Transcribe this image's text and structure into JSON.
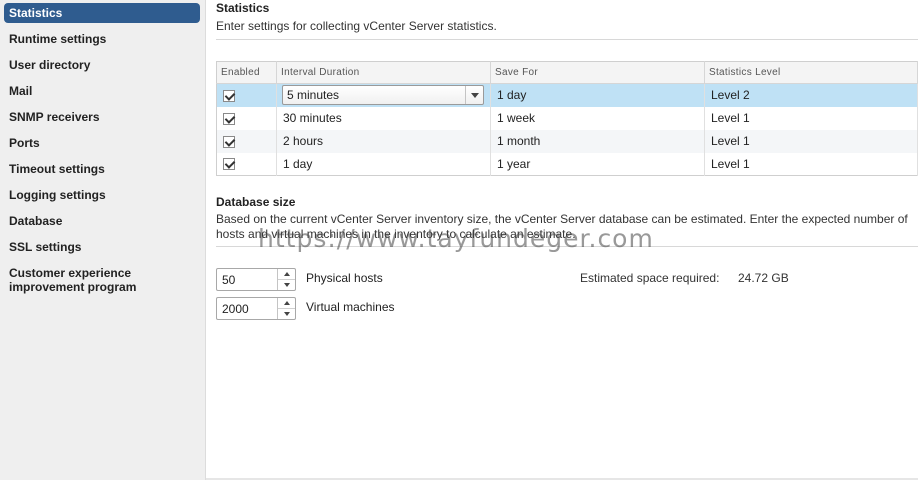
{
  "sidebar": {
    "items": [
      {
        "label": "Statistics",
        "active": true
      },
      {
        "label": "Runtime settings"
      },
      {
        "label": "User directory"
      },
      {
        "label": "Mail"
      },
      {
        "label": "SNMP receivers"
      },
      {
        "label": "Ports"
      },
      {
        "label": "Timeout settings"
      },
      {
        "label": "Logging settings"
      },
      {
        "label": "Database"
      },
      {
        "label": "SSL settings"
      },
      {
        "label": "Customer experience improvement program"
      }
    ]
  },
  "statistics": {
    "title": "Statistics",
    "description": "Enter settings for collecting vCenter Server statistics.",
    "table": {
      "headers": [
        "Enabled",
        "Interval Duration",
        "Save For",
        "Statistics Level"
      ],
      "rows": [
        {
          "enabled": true,
          "interval": "5 minutes",
          "save_for": "1 day",
          "level": "Level 2",
          "selected": true
        },
        {
          "enabled": true,
          "interval": "30 minutes",
          "save_for": "1 week",
          "level": "Level 1"
        },
        {
          "enabled": true,
          "interval": "2 hours",
          "save_for": "1 month",
          "level": "Level 1"
        },
        {
          "enabled": true,
          "interval": "1 day",
          "save_for": "1 year",
          "level": "Level 1"
        }
      ]
    }
  },
  "database": {
    "title": "Database size",
    "description": "Based on the current vCenter Server inventory size, the vCenter Server database can be estimated. Enter the expected number of hosts and virtual machines in the inventory to calculate an estimate.",
    "physical_hosts": {
      "value": "50",
      "label": "Physical hosts"
    },
    "virtual_machines": {
      "value": "2000",
      "label": "Virtual machines"
    },
    "estimate_label": "Estimated space required:",
    "estimate_value": "24.72 GB"
  },
  "watermark": "https://www.tayfundeger.com",
  "colors": {
    "sidebar_active": "#2f5c8f",
    "selected_row": "#bfe1f5",
    "sidebar_bg": "#efefef"
  }
}
